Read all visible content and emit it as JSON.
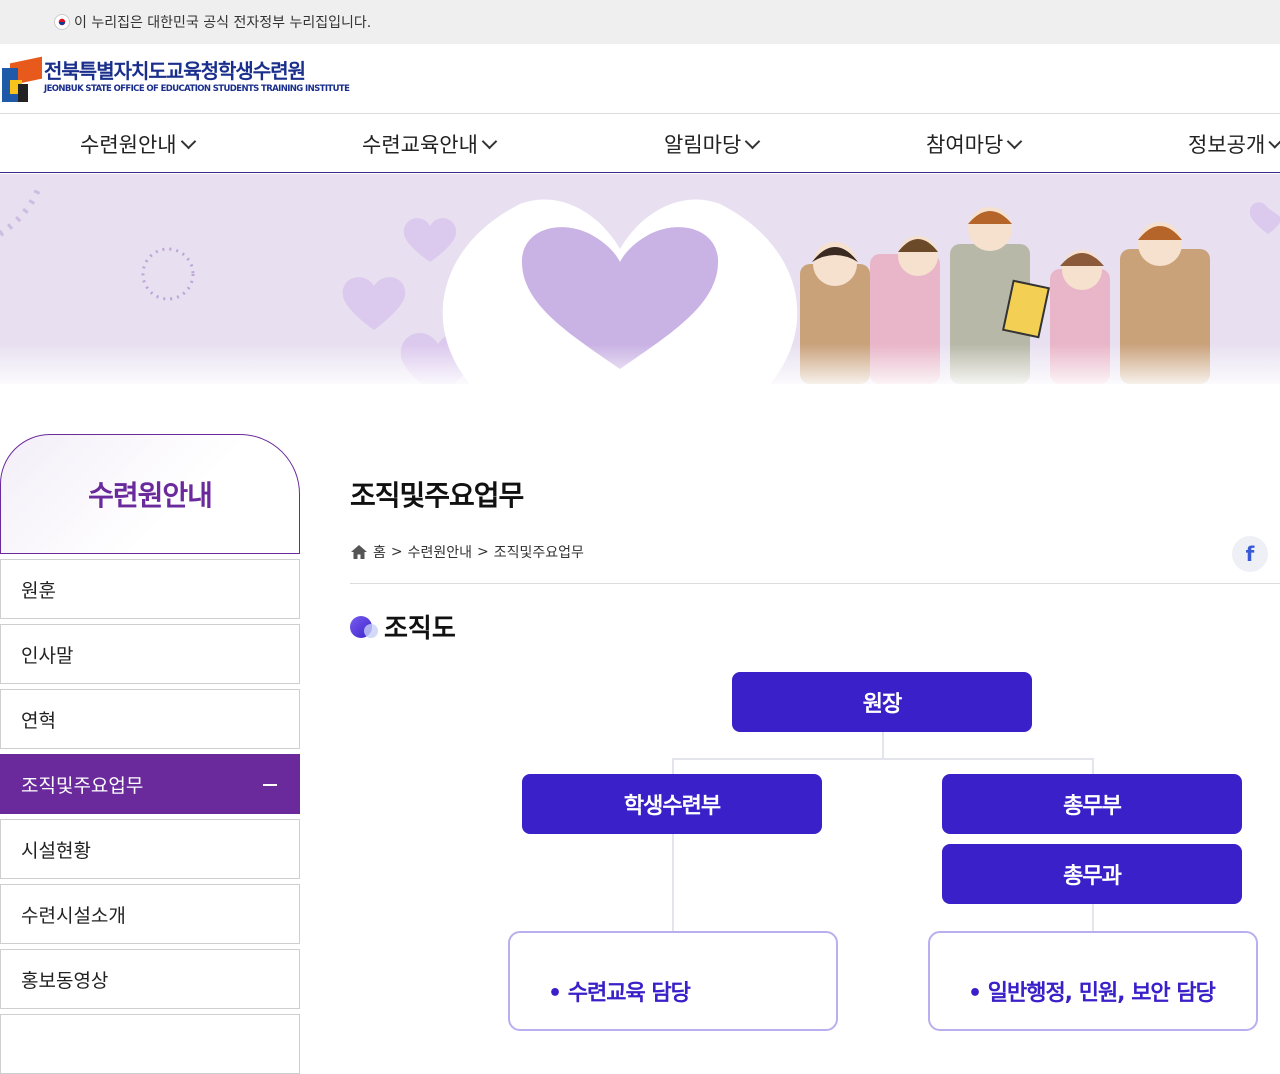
{
  "gov_banner": {
    "text": "이 누리집은 대한민국 공식 전자정부 누리집입니다."
  },
  "header": {
    "logo_title": "전북특별자치도교육청학생수련원",
    "logo_subtitle": "JEONBUK STATE OFFICE OF EDUCATION STUDENTS TRAINING INSTITUTE"
  },
  "gnb": {
    "items": [
      {
        "label": "수련원안내"
      },
      {
        "label": "수련교육안내"
      },
      {
        "label": "알림마당"
      },
      {
        "label": "참여마당"
      },
      {
        "label": "정보공개"
      }
    ]
  },
  "sidebar": {
    "title": "수련원안내",
    "items": [
      {
        "label": "원훈"
      },
      {
        "label": "인사말"
      },
      {
        "label": "연혁"
      },
      {
        "label": "조직및주요업무"
      },
      {
        "label": "시설현황"
      },
      {
        "label": "수련시설소개"
      },
      {
        "label": "홍보동영상"
      }
    ],
    "active_index": 3
  },
  "content": {
    "page_title": "조직및주요업무",
    "breadcrumb": {
      "home": "홈",
      "sep": ">",
      "level1": "수련원안내",
      "level2": "조직및주요업무"
    },
    "share_icon": "facebook-icon",
    "section_title": "조직도",
    "org": {
      "director": "원장",
      "dept_left": "학생수련부",
      "dept_right": "총무부",
      "team_right": "총무과",
      "duties_left": [
        "• 수련교육 담당"
      ],
      "duties_right": [
        "• 일반행정, 민원, 보안 담당"
      ]
    }
  },
  "colors": {
    "accent_purple": "#6a2a9c",
    "org_blue": "#3a20c8",
    "banner_bg": "#e8e0f0",
    "logo_navy": "#1a2f8c"
  }
}
